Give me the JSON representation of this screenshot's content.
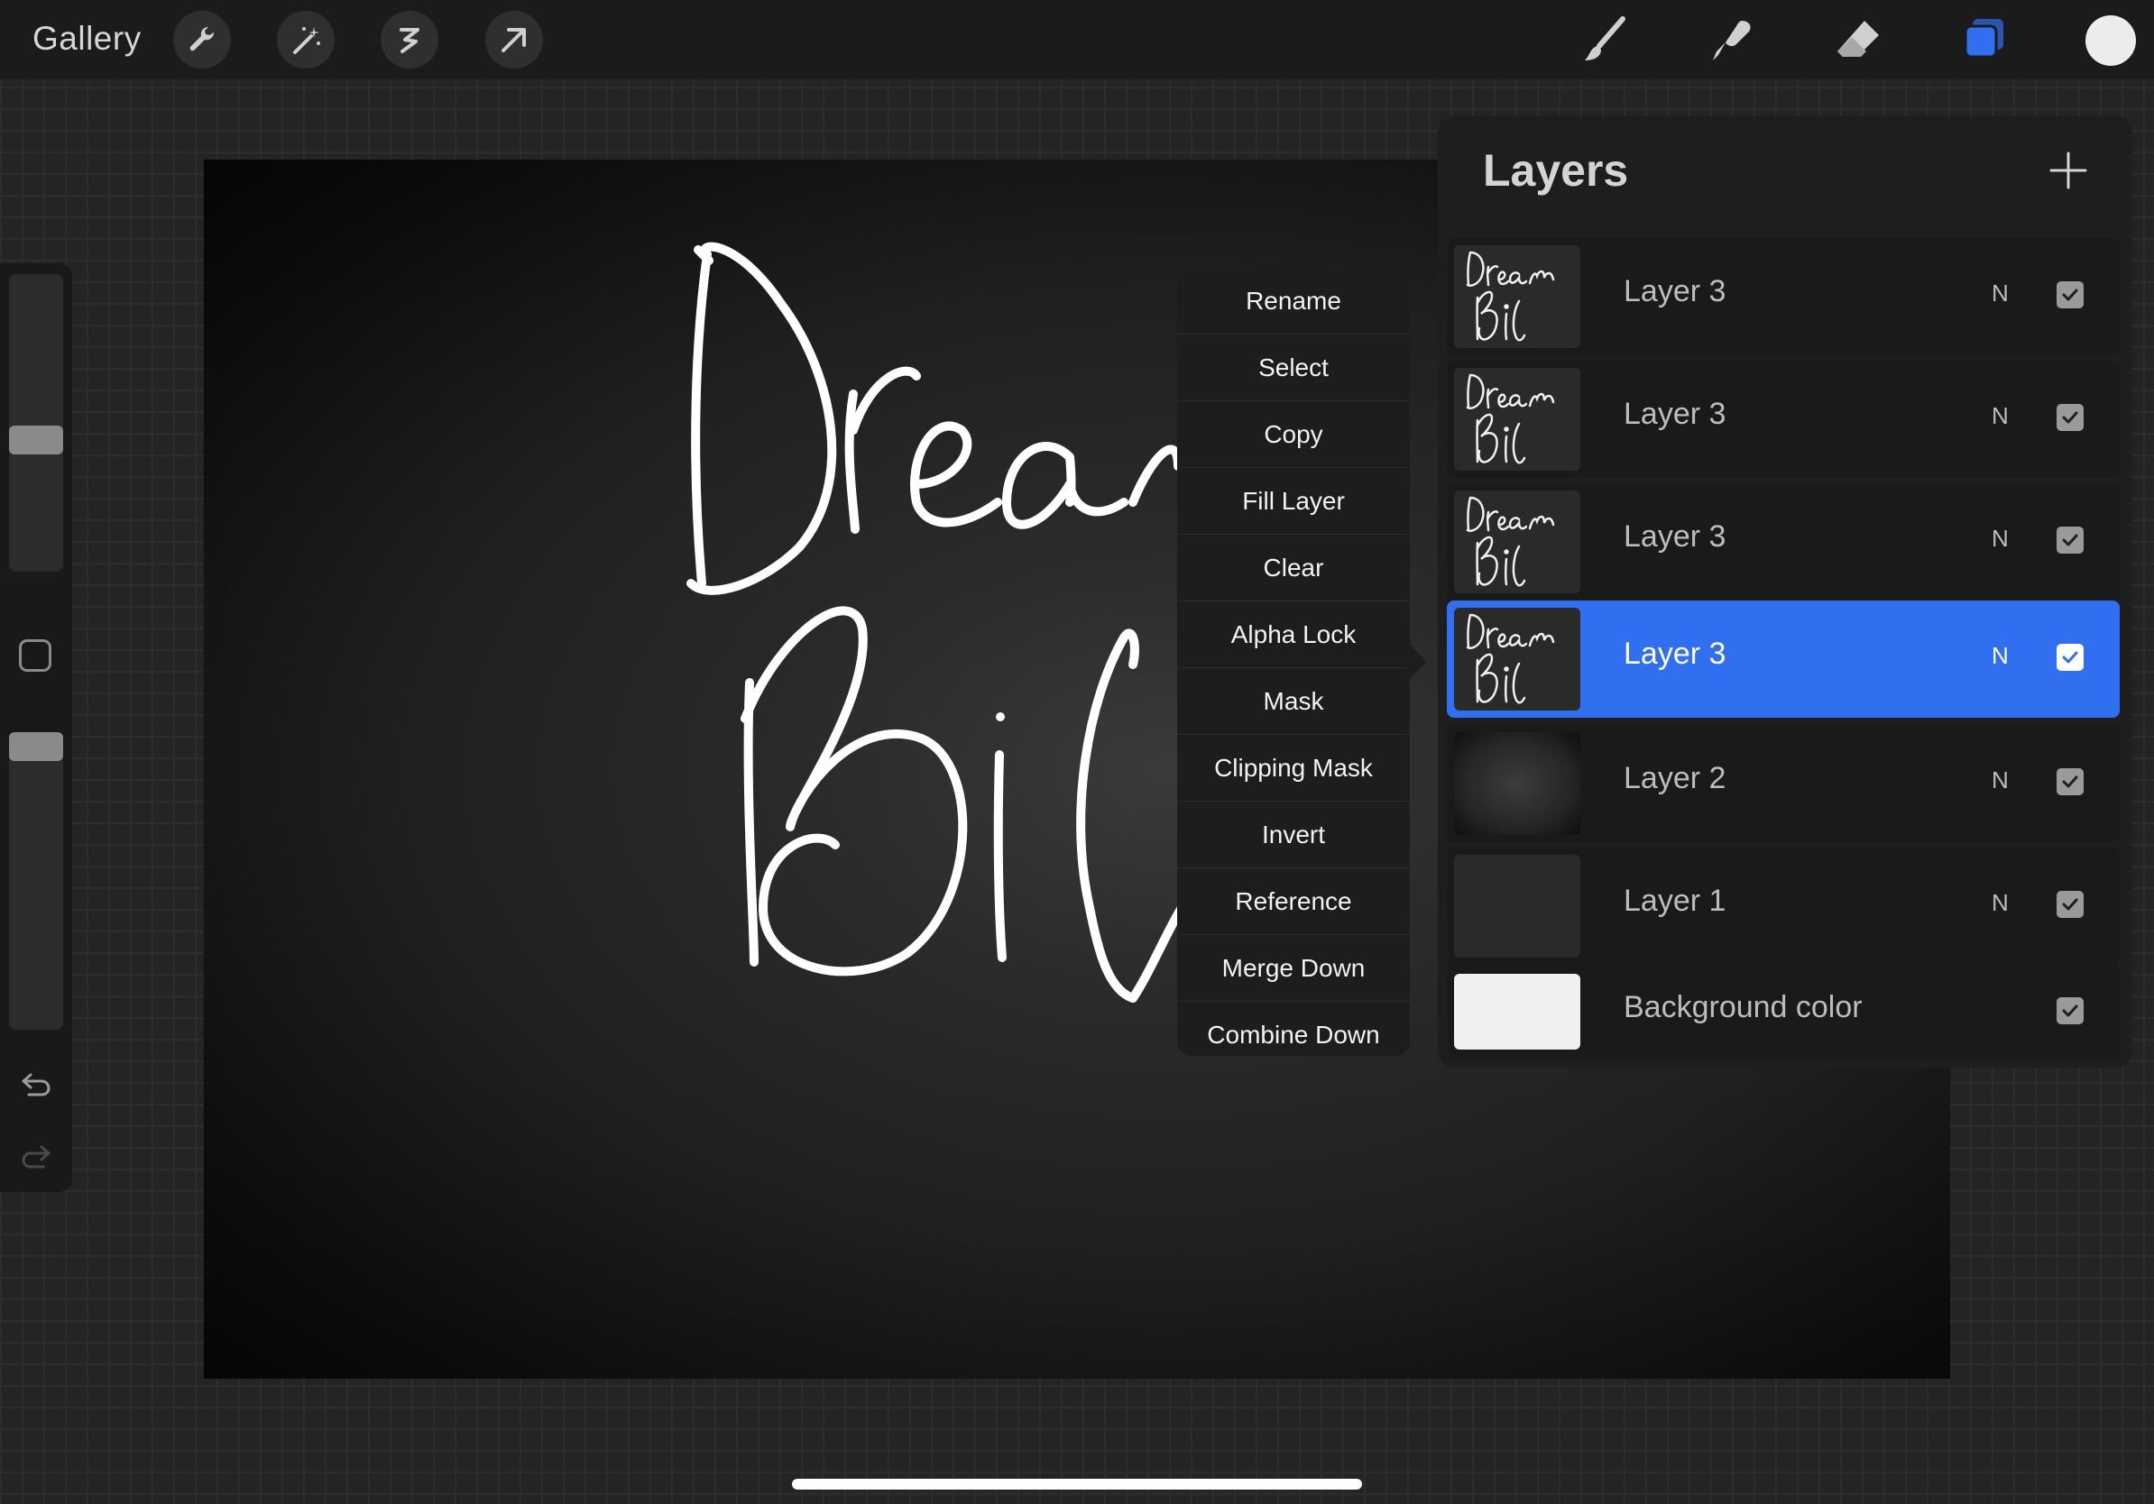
{
  "topbar": {
    "gallery_label": "Gallery",
    "left_tools": [
      "wrench-icon",
      "magic-wand-icon",
      "selection-icon",
      "transform-arrow-icon"
    ],
    "right_tools": [
      "brush-icon",
      "smudge-icon",
      "eraser-icon",
      "layers-icon"
    ],
    "color_swatch": "#ececec",
    "accent": "#2f6ff0"
  },
  "canvas": {
    "drawing": "Dream Big (handwritten, partly hidden)"
  },
  "context_menu": {
    "items": [
      "Rename",
      "Select",
      "Copy",
      "Fill Layer",
      "Clear",
      "Alpha Lock",
      "Mask",
      "Clipping Mask",
      "Invert",
      "Reference",
      "Merge Down",
      "Combine Down"
    ]
  },
  "layers_panel": {
    "title": "Layers",
    "layers": [
      {
        "name": "Layer 3",
        "blend": "N",
        "visible": true,
        "active": false
      },
      {
        "name": "Layer 3",
        "blend": "N",
        "visible": true,
        "active": false
      },
      {
        "name": "Layer 3",
        "blend": "N",
        "visible": true,
        "active": false
      },
      {
        "name": "Layer 3",
        "blend": "N",
        "visible": true,
        "active": true
      },
      {
        "name": "Layer 2",
        "blend": "N",
        "visible": true,
        "active": false
      },
      {
        "name": "Layer 1",
        "blend": "N",
        "visible": true,
        "active": false
      },
      {
        "name": "Background color",
        "blend": "",
        "visible": true,
        "active": false
      }
    ]
  }
}
